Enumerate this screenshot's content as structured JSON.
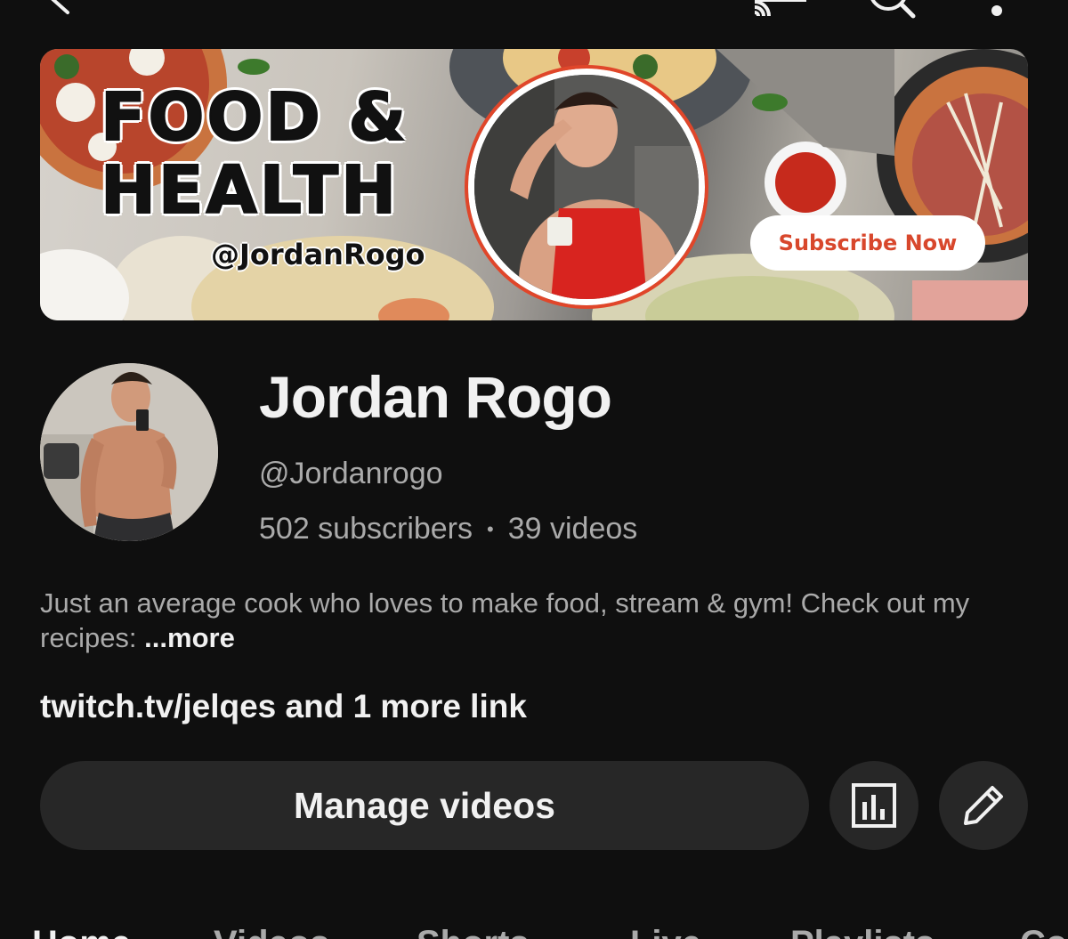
{
  "topbar": {
    "back_icon": "chevron-left-icon",
    "cast_icon": "cast-icon",
    "search_icon": "search-icon",
    "more_icon": "more-vertical-icon"
  },
  "banner": {
    "title_line1": "FOOD &",
    "title_line2": "HEALTH",
    "handle": "@JordanRogo",
    "subscribe_label": "Subscribe Now",
    "accent_color": "#d8472c"
  },
  "channel": {
    "name": "Jordan Rogo",
    "handle": "@Jordanrogo",
    "subscribers": "502 subscribers",
    "separator": "•",
    "videos": "39 videos",
    "description": "Just an average cook who loves to make food, stream & gym! Check out my recipes: ",
    "more_label": "...more",
    "links": "twitch.tv/jelqes and 1 more link"
  },
  "actions": {
    "manage_label": "Manage videos",
    "analytics_icon": "analytics-icon",
    "edit_icon": "pencil-icon"
  },
  "tabs": [
    {
      "label": "Home"
    },
    {
      "label": "Videos"
    },
    {
      "label": "Shorts"
    },
    {
      "label": "Live"
    },
    {
      "label": "Playlists"
    },
    {
      "label": "Community"
    }
  ]
}
